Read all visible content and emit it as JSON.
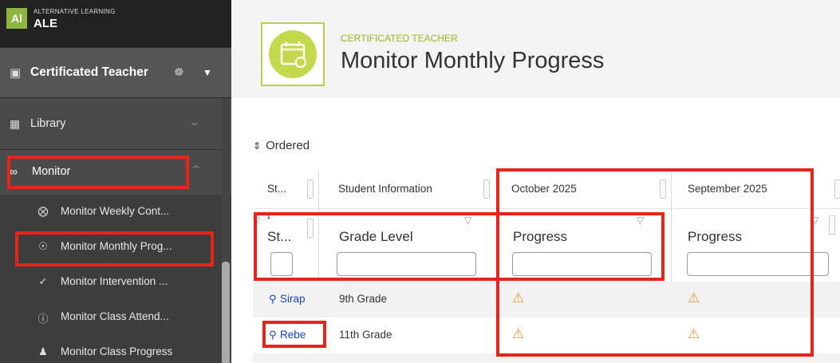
{
  "brand": {
    "logo": "Al",
    "subtitle": "ALTERNATIVE LEARNING",
    "title": "ALE"
  },
  "role": {
    "label": "Certificated Teacher"
  },
  "nav": {
    "library": "Library",
    "monitor": "Monitor",
    "sub_items": [
      {
        "icon": "times-circle-icon",
        "label": "Monitor Weekly Cont..."
      },
      {
        "icon": "search-circle-icon",
        "label": "Monitor Monthly Prog..."
      },
      {
        "icon": "check-icon",
        "label": "Monitor Intervention ..."
      },
      {
        "icon": "question-circle-icon",
        "label": "Monitor Class Attend..."
      },
      {
        "icon": "users-icon",
        "label": "Monitor Class Progress"
      }
    ]
  },
  "page": {
    "supertitle": "CERTIFICATED TEACHER",
    "title": "Monitor Monthly Progress"
  },
  "ordered_label": "Ordered",
  "grid": {
    "columns": [
      "St...",
      "Student Information",
      "October 2025",
      "September 2025"
    ],
    "filter_labels": [
      "St...",
      "Grade Level",
      "Progress",
      "Progress"
    ],
    "sort_badge": "1",
    "rows": [
      {
        "student": "Sirap",
        "grade": "9th Grade"
      },
      {
        "student": "Rebe",
        "grade": "11th Grade"
      }
    ]
  },
  "colors": {
    "accent_green": "#9ab321",
    "highlight_red": "#e8231a",
    "warning": "#e3993a",
    "link_blue": "#1a3fc9"
  }
}
